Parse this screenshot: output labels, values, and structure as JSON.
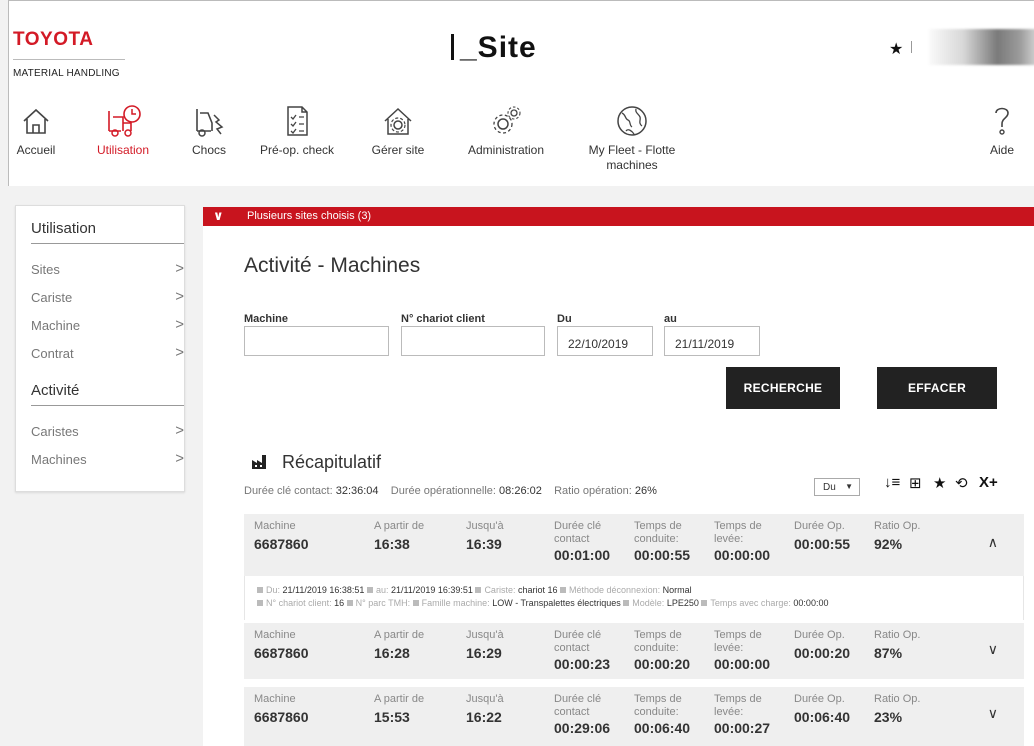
{
  "header": {
    "brand": "TOYOTA",
    "brand_sub": "MATERIAL HANDLING",
    "app_title": "_Site",
    "star": "★"
  },
  "nav": [
    {
      "label": "Accueil",
      "icon": "home-icon"
    },
    {
      "label": "Utilisation",
      "icon": "forklift-clock-icon"
    },
    {
      "label": "Chocs",
      "icon": "forklift-crash-icon"
    },
    {
      "label": "Pré-op. check",
      "icon": "checklist-icon"
    },
    {
      "label": "Gérer site",
      "icon": "house-gear-icon"
    },
    {
      "label": "Administration",
      "icon": "gears-icon"
    },
    {
      "label": "My Fleet - Flotte",
      "label2": "machines",
      "icon": "globe-icon"
    },
    {
      "label": "Aide",
      "icon": "question-icon"
    }
  ],
  "sidebar": {
    "section1": "Utilisation",
    "items1": [
      "Sites",
      "Cariste",
      "Machine",
      "Contrat"
    ],
    "section2": "Activité",
    "items2": [
      "Caristes",
      "Machines"
    ],
    "chevron": ">"
  },
  "banner": {
    "text": "Plusieurs sites choisis (3)",
    "chevron": "∨"
  },
  "page": {
    "title": "Activité - Machines"
  },
  "filters": {
    "machine_label": "Machine",
    "machine_value": "",
    "chariot_label": "N° chariot client",
    "chariot_value": "",
    "du_label": "Du",
    "du_value": "22/10/2019",
    "au_label": "au",
    "au_value": "21/11/2019",
    "search_button": "RECHERCHE",
    "clear_button": "EFFACER"
  },
  "recap": {
    "title": "Récapitulatif",
    "contact_label": "Durée clé contact:",
    "contact_value": "32:36:04",
    "op_label": "Durée opérationnelle:",
    "op_value": "08:26:02",
    "ratio_label": "Ratio opération:",
    "ratio_value": "26%",
    "sort_select": "Du",
    "tools": [
      "↓≡",
      "⊞",
      "★",
      "⟲",
      "X+"
    ]
  },
  "columns": {
    "machine": "Machine",
    "from": "A partir de",
    "to": "Jusqu'à",
    "contact1": "Durée clé",
    "contact2": "contact",
    "drive1": "Temps de",
    "drive2": "conduite:",
    "lift1": "Temps de",
    "lift2": "levée:",
    "op": "Durée Op.",
    "ratio": "Ratio Op."
  },
  "rows": [
    {
      "machine": "6687860",
      "from": "16:38",
      "to": "16:39",
      "contact": "00:01:00",
      "drive": "00:00:55",
      "lift": "00:00:00",
      "op": "00:00:55",
      "ratio": "92%",
      "chevron": "∧"
    },
    {
      "machine": "6687860",
      "from": "16:28",
      "to": "16:29",
      "contact": "00:00:23",
      "drive": "00:00:20",
      "lift": "00:00:00",
      "op": "00:00:20",
      "ratio": "87%",
      "chevron": "∨"
    },
    {
      "machine": "6687860",
      "from": "15:53",
      "to": "16:22",
      "contact": "00:29:06",
      "drive": "00:06:40",
      "lift": "00:00:27",
      "op": "00:06:40",
      "ratio": "23%",
      "chevron": "∨"
    }
  ],
  "detail": {
    "du_label": "Du:",
    "du_value": "21/11/2019 16:38:51",
    "au_label": "au:",
    "au_value": "21/11/2019 16:39:51",
    "cariste_label": "Cariste:",
    "cariste_value": "chariot 16",
    "method_label": "Méthode déconnexion:",
    "method_value": "Normal",
    "chariot_label": "N° chariot client:",
    "chariot_value": "16",
    "parc_label": "N° parc TMH:",
    "parc_value": "",
    "famille_label": "Famille machine:",
    "famille_value": "LOW - Transpalettes électriques",
    "modele_label": "Modèle:",
    "modele_value": "LPE250",
    "charge_label": "Temps avec charge:",
    "charge_value": "00:00:00"
  }
}
